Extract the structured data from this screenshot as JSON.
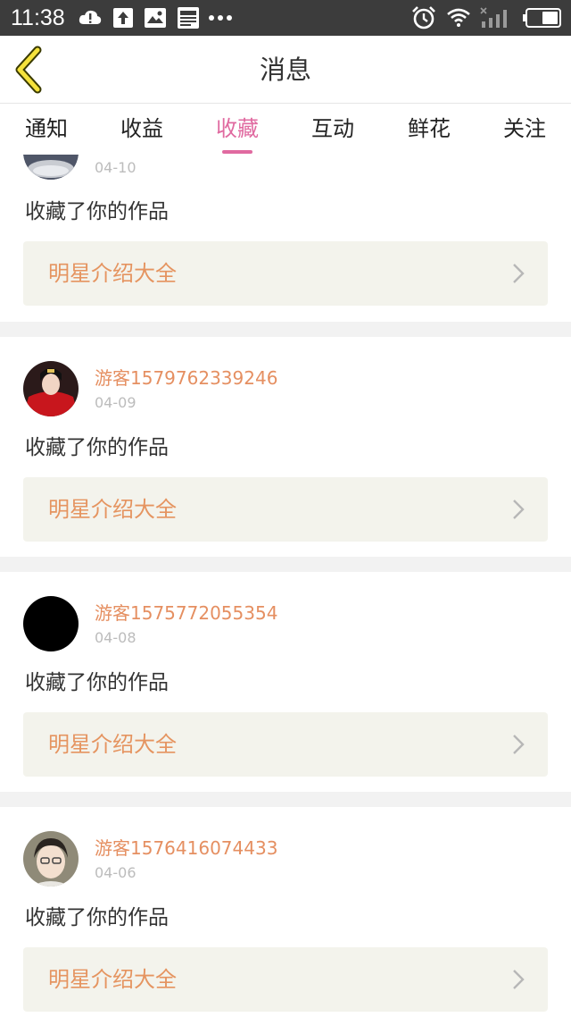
{
  "status_bar": {
    "time": "11:38",
    "icons": [
      "cloud-alert-icon",
      "upload-icon",
      "image-icon",
      "news-icon",
      "more-dots-icon",
      "alarm-icon",
      "wifi-icon",
      "signal-icon",
      "battery-icon"
    ]
  },
  "header": {
    "title": "消息",
    "back_icon": "chevron-left-icon"
  },
  "tabs": [
    {
      "label": "通知",
      "active": false
    },
    {
      "label": "收益",
      "active": false
    },
    {
      "label": "收藏",
      "active": true
    },
    {
      "label": "互动",
      "active": false
    },
    {
      "label": "鲜花",
      "active": false
    },
    {
      "label": "关注",
      "active": false
    }
  ],
  "accent_color": "#e06aa0",
  "messages": [
    {
      "username": "",
      "date": "04-10",
      "action": "收藏了你的作品",
      "work_title": "明星介绍大全"
    },
    {
      "username": "游客1579762339246",
      "date": "04-09",
      "action": "收藏了你的作品",
      "work_title": "明星介绍大全"
    },
    {
      "username": "游客1575772055354",
      "date": "04-08",
      "action": "收藏了你的作品",
      "work_title": "明星介绍大全"
    },
    {
      "username": "游客1576416074433",
      "date": "04-06",
      "action": "收藏了你的作品",
      "work_title": "明星介绍大全"
    }
  ]
}
